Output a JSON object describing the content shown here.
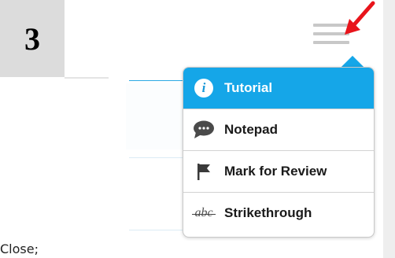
{
  "question": {
    "number": "3"
  },
  "menu": {
    "items": [
      {
        "label": "Tutorial",
        "icon": "info-icon"
      },
      {
        "label": "Notepad",
        "icon": "speech-bubble-icon"
      },
      {
        "label": "Mark for Review",
        "icon": "flag-icon"
      },
      {
        "label": "Strikethrough",
        "icon": "strikethrough-icon",
        "glyph": "abc"
      }
    ],
    "active_index": 0
  },
  "footer": {
    "text": "Close;"
  },
  "colors": {
    "accent": "#15a6e8",
    "arrow": "#e8141b"
  }
}
